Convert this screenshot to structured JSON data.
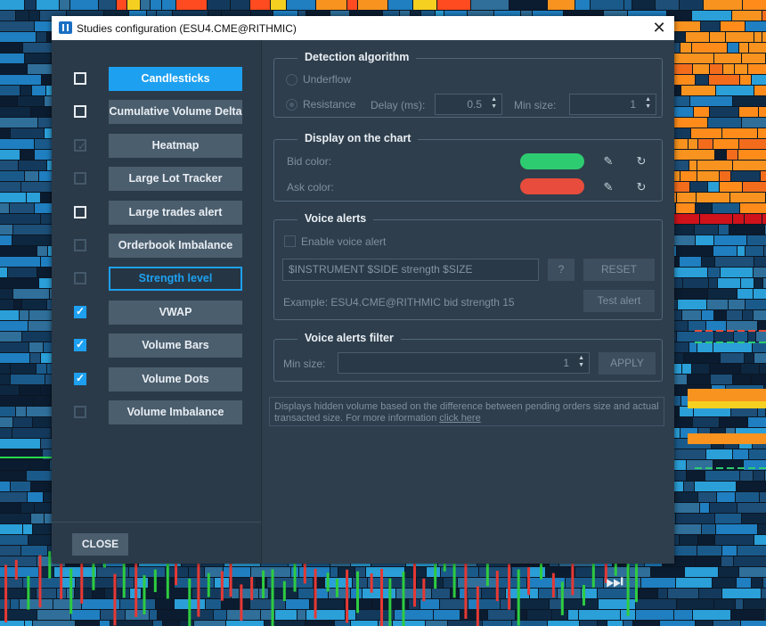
{
  "window": {
    "title": "Studies configuration (ESU4.CME@RITHMIC)",
    "close_glyph": "✕"
  },
  "studies": [
    {
      "label": "Candlesticks",
      "checked": false,
      "enabled": true,
      "state": "active"
    },
    {
      "label": "Cumulative Volume Delta",
      "checked": false,
      "enabled": true,
      "state": "normal"
    },
    {
      "label": "Heatmap",
      "checked": true,
      "enabled": false,
      "state": "normal"
    },
    {
      "label": "Large Lot Tracker",
      "checked": false,
      "enabled": false,
      "state": "normal"
    },
    {
      "label": "Large trades alert",
      "checked": false,
      "enabled": true,
      "state": "normal"
    },
    {
      "label": "Orderbook Imbalance",
      "checked": false,
      "enabled": false,
      "state": "normal"
    },
    {
      "label": "Strength level",
      "checked": false,
      "enabled": false,
      "state": "selected"
    },
    {
      "label": "VWAP",
      "checked": true,
      "enabled": true,
      "state": "normal"
    },
    {
      "label": "Volume Bars",
      "checked": true,
      "enabled": true,
      "state": "normal"
    },
    {
      "label": "Volume Dots",
      "checked": true,
      "enabled": true,
      "state": "normal"
    },
    {
      "label": "Volume Imbalance",
      "checked": false,
      "enabled": false,
      "state": "normal"
    }
  ],
  "close_button": "CLOSE",
  "detection": {
    "title": "Detection algorithm",
    "underflow_label": "Underflow",
    "resistance_label": "Resistance",
    "selected": "Resistance",
    "delay_label": "Delay (ms):",
    "delay_value": "0.5",
    "min_size_label": "Min size:",
    "min_size_value": "1"
  },
  "display": {
    "title": "Display on the chart",
    "bid_label": "Bid color:",
    "ask_label": "Ask color:",
    "bid_color": "#2ecc71",
    "ask_color": "#e74c3c",
    "picker_icon": "eyedropper-icon",
    "reset_icon": "reset-icon"
  },
  "voice_alerts": {
    "title": "Voice alerts",
    "enable_label": "Enable voice alert",
    "enabled": false,
    "template_value": "$INSTRUMENT $SIDE strength $SIZE",
    "help_label": "?",
    "reset_label": "RESET",
    "example_text": "Example: ESU4.CME@RITHMIC bid strength 15",
    "test_label": "Test alert"
  },
  "voice_filter": {
    "title": "Voice alerts filter",
    "min_size_label": "Min size:",
    "min_size_value": "1",
    "apply_label": "APPLY"
  },
  "info": {
    "text": "Displays hidden volume based on the difference between pending orders size and actual transacted size. For more information ",
    "link": "click here"
  },
  "colors": {
    "accent": "#1ea0f0",
    "dialog_bg": "#2e3e4c",
    "button_bg": "#4b5e6e"
  },
  "playback_icon": "skip-forward-icon"
}
